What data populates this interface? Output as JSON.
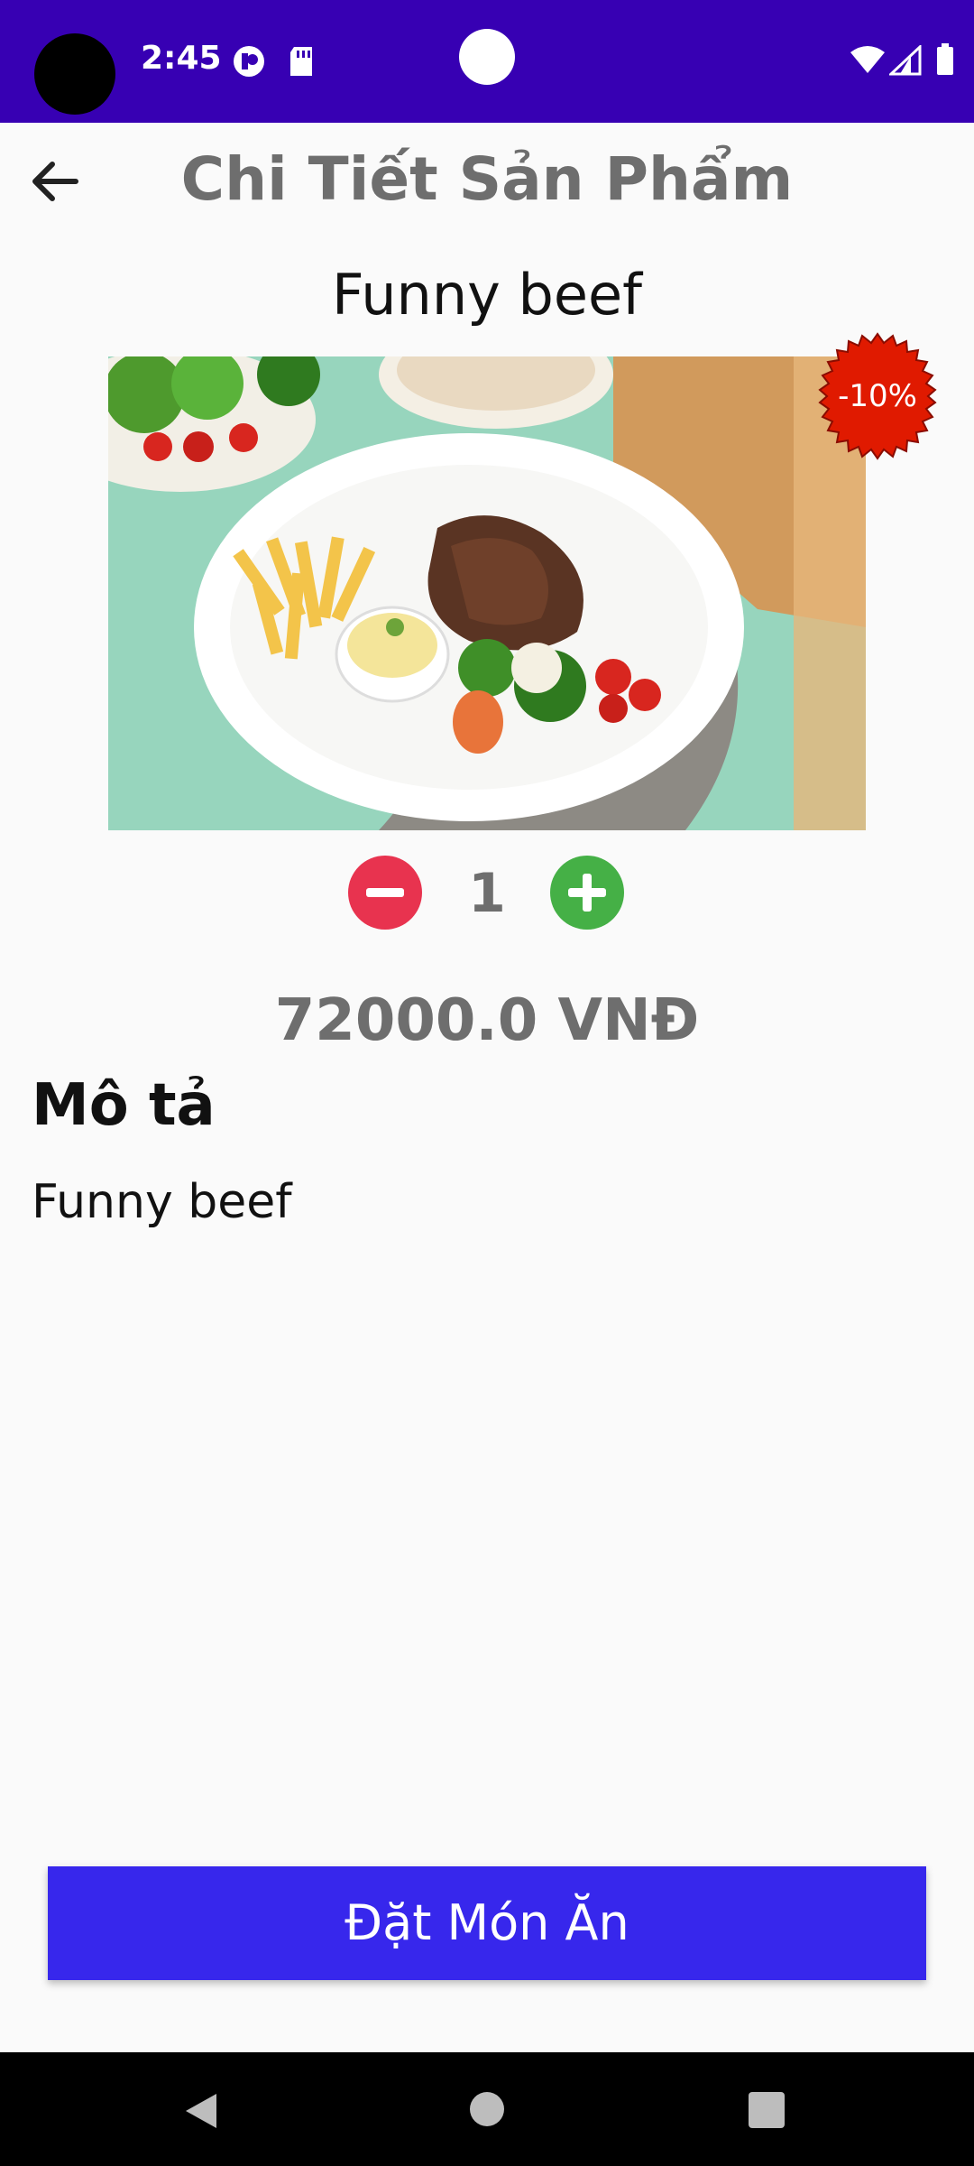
{
  "status_bar": {
    "time": "2:45",
    "icons": [
      "app-notification-icon",
      "sd-card-icon",
      "wifi-icon",
      "signal-icon",
      "battery-icon"
    ]
  },
  "app_bar": {
    "back_icon": "arrow-left-icon",
    "title": "Chi Tiết Sản Phẩm"
  },
  "product": {
    "name": "Funny beef",
    "discount_badge": "-10%",
    "quantity": "1",
    "price": "72000.0 VNĐ",
    "description_heading": "Mô tả",
    "description": "Funny beef"
  },
  "actions": {
    "order_button": "Đặt Món Ăn",
    "decrease_icon": "minus-circle-icon",
    "increase_icon": "plus-circle-icon"
  },
  "nav_bar": {
    "icons": [
      "nav-back-icon",
      "nav-home-icon",
      "nav-recents-icon"
    ]
  },
  "colors": {
    "status_bar": "#3700b3",
    "order_button": "#3727ec",
    "minus_button": "#e8334f",
    "plus_button": "#45b046",
    "badge": "#e01a00",
    "muted_text": "#6e6e6e"
  }
}
